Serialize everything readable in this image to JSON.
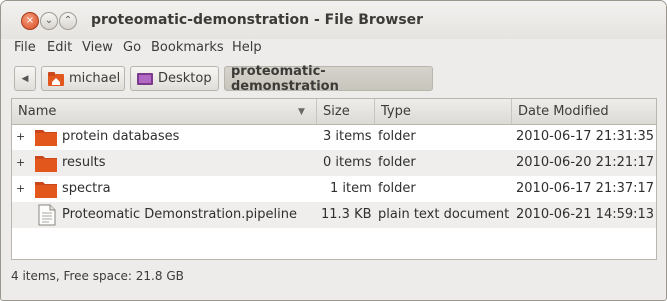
{
  "window": {
    "title": "proteomatic-demonstration - File Browser",
    "close_glyph": "×",
    "min_glyph": "⌄",
    "max_glyph": "⌃"
  },
  "menubar": {
    "items": [
      "File",
      "Edit",
      "View",
      "Go",
      "Bookmarks",
      "Help"
    ]
  },
  "pathbar": {
    "back_glyph": "◀",
    "crumbs": [
      "michael",
      "Desktop",
      "proteomatic-demonstration"
    ]
  },
  "listview": {
    "columns": [
      "Name",
      "Size",
      "Type",
      "Date Modified"
    ],
    "sort_glyph": "▼",
    "rows": [
      {
        "expander": "+",
        "icon": "folder-icon",
        "name": "protein databases",
        "size": "3 items",
        "type": "folder",
        "date": "2010-06-17 21:31:35"
      },
      {
        "expander": "+",
        "icon": "folder-icon",
        "name": "results",
        "size": "0 items",
        "type": "folder",
        "date": "2010-06-20 21:21:17"
      },
      {
        "expander": "+",
        "icon": "folder-icon",
        "name": "spectra",
        "size": "1 item",
        "type": "folder",
        "date": "2010-06-17 21:37:17"
      },
      {
        "expander": "",
        "icon": "text-document-icon",
        "name": "Proteomatic Demonstration.pipeline",
        "size": "11.3 KB",
        "type": "plain text document",
        "date": "2010-06-21 14:59:13"
      }
    ]
  },
  "statusbar": {
    "text": "4 items, Free space: 21.8 GB"
  },
  "colors": {
    "folder": "#e2571c",
    "close_button": "#d94f24",
    "window_bg": "#edeceb"
  }
}
